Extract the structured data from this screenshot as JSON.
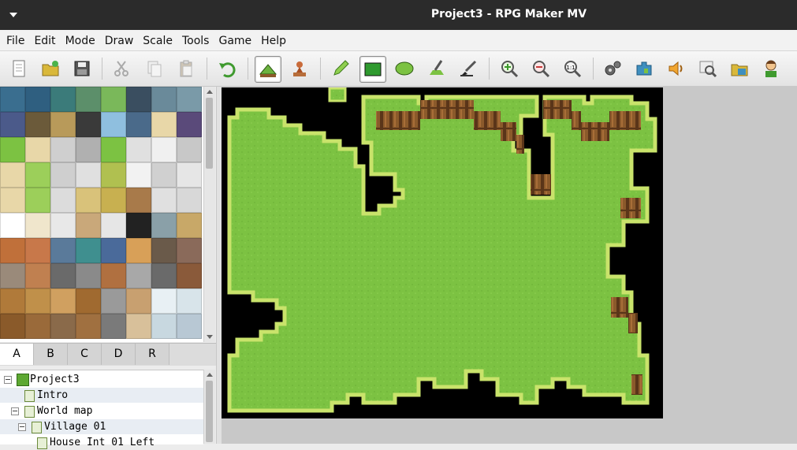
{
  "window": {
    "title": "Project3 - RPG Maker MV"
  },
  "menu": [
    "File",
    "Edit",
    "Mode",
    "Draw",
    "Scale",
    "Tools",
    "Game",
    "Help"
  ],
  "toolbar": [
    {
      "name": "new-project-icon"
    },
    {
      "name": "open-project-icon"
    },
    {
      "name": "save-project-icon"
    },
    {
      "name": "cut-icon"
    },
    {
      "name": "copy-icon"
    },
    {
      "name": "paste-icon"
    },
    {
      "name": "undo-icon"
    },
    {
      "name": "map-mode-icon"
    },
    {
      "name": "event-mode-icon"
    },
    {
      "name": "pencil-icon"
    },
    {
      "name": "rectangle-icon"
    },
    {
      "name": "ellipse-icon"
    },
    {
      "name": "fill-icon"
    },
    {
      "name": "shadow-pen-icon"
    },
    {
      "name": "zoom-in-icon"
    },
    {
      "name": "zoom-out-icon"
    },
    {
      "name": "actual-size-icon"
    },
    {
      "name": "database-icon"
    },
    {
      "name": "plugin-manager-icon"
    },
    {
      "name": "sound-test-icon"
    },
    {
      "name": "event-searcher-icon"
    },
    {
      "name": "resource-manager-icon"
    },
    {
      "name": "character-generator-icon"
    }
  ],
  "tileset_tabs": [
    "A",
    "B",
    "C",
    "D",
    "R"
  ],
  "map_tree": [
    {
      "label": "Project3",
      "depth": 0,
      "kind": "project"
    },
    {
      "label": "Intro",
      "depth": 1,
      "kind": "map"
    },
    {
      "label": "World map",
      "depth": 1,
      "kind": "map"
    },
    {
      "label": "Village 01",
      "depth": 2,
      "kind": "map"
    },
    {
      "label": "House Int 01 Left",
      "depth": 3,
      "kind": "map"
    }
  ],
  "colors": {
    "grass": "#7cc242",
    "void": "#000000",
    "titlebar": "#2b2b2b"
  }
}
